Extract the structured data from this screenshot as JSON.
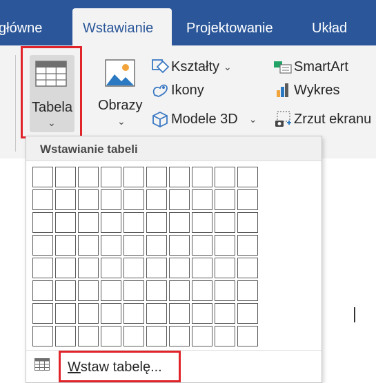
{
  "tabs": [
    {
      "label": "główne",
      "active": false
    },
    {
      "label": "Wstawianie",
      "active": true
    },
    {
      "label": "Projektowanie",
      "active": false
    },
    {
      "label": "Układ",
      "active": false
    }
  ],
  "ribbon": {
    "tabela": {
      "label": "Tabela",
      "icon": "table-icon",
      "chevron": "⌄"
    },
    "obrazy": {
      "label": "Obrazy",
      "icon": "picture-icon",
      "chevron": "⌄"
    },
    "ksztalty": {
      "label": "Kształty",
      "icon": "shapes-icon",
      "chevron": "⌄"
    },
    "ikony": {
      "label": "Ikony",
      "icon": "icons-icon"
    },
    "modele3d": {
      "label": "Modele 3D",
      "icon": "cube-icon",
      "chevron": "⌄"
    },
    "smartart": {
      "label": "SmartArt",
      "icon": "smartart-icon"
    },
    "wykres": {
      "label": "Wykres",
      "icon": "chart-icon"
    },
    "zrzut": {
      "label": "Zrzut ekranu",
      "icon": "screenshot-icon"
    }
  },
  "dropdown": {
    "header": "Wstawianie tabeli",
    "grid": {
      "columns": 10,
      "rows": 8
    },
    "insert_table": {
      "accel": "W",
      "rest": "staw tabelę..."
    }
  },
  "colors": {
    "title_bar": "#2b579a",
    "ribbon": "#f3f3f3",
    "highlight": "#e0242a"
  }
}
